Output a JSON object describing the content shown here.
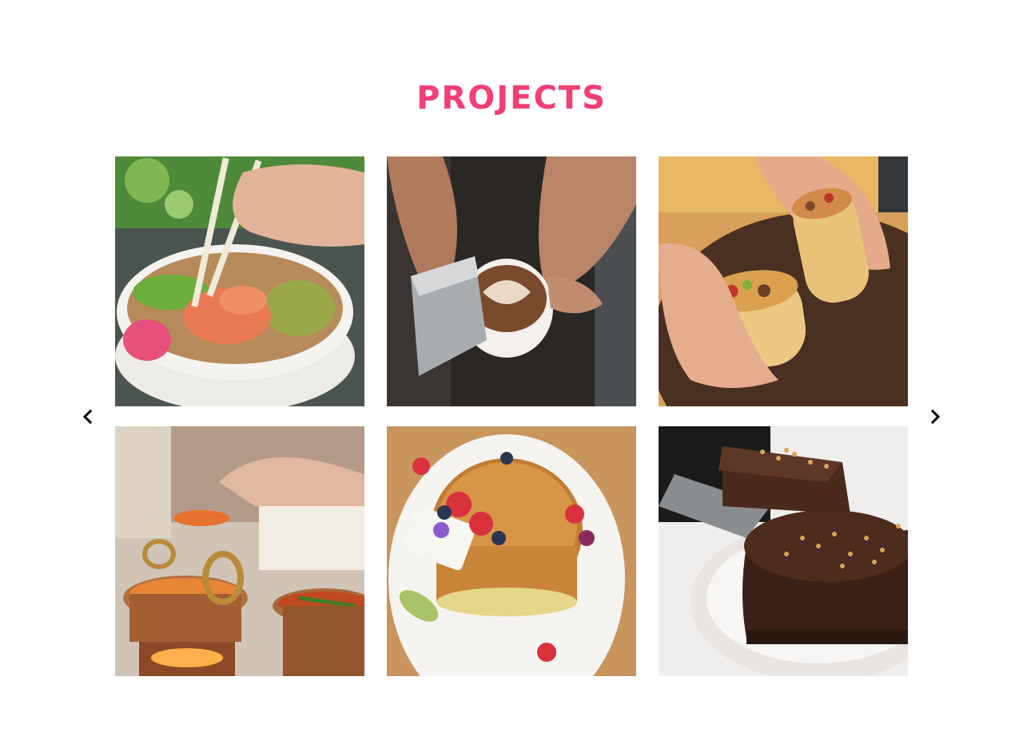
{
  "section": {
    "title": "PROJECTS",
    "accent_color": "#f23f74"
  },
  "carousel": {
    "prev_icon": "chevron-left-icon",
    "next_icon": "chevron-right-icon",
    "items": [
      {
        "subject": "poke-bowl-with-chopsticks"
      },
      {
        "subject": "latte-art-pour"
      },
      {
        "subject": "burrito-halves"
      },
      {
        "subject": "copper-curry-pots"
      },
      {
        "subject": "pancake-stack-with-berries"
      },
      {
        "subject": "chocolate-cake-slice"
      }
    ]
  }
}
